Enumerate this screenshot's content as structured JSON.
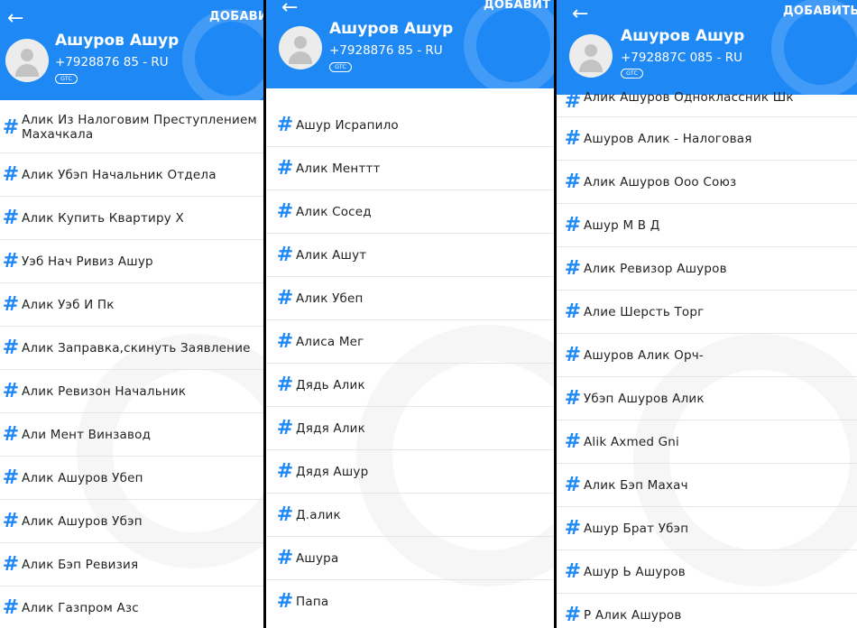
{
  "colors": {
    "accent": "#1e88f5",
    "header_text": "#ffffff",
    "item_text": "#222222"
  },
  "icons": {
    "back": "arrow-left-icon",
    "avatar": "person-icon",
    "tag": "hash-icon",
    "watermark": "phone-watermark-icon"
  },
  "panels": [
    {
      "header": {
        "back": "←",
        "add": "ДОБАВИ",
        "name": "Ашуров Ашур",
        "phone": "+7928876     85 - RU",
        "operator": "GTC"
      },
      "items": [
        "Алик Из Налоговим Преступлением Махачкала",
        "Алик Убэп Начальник Отдела",
        "Алик Купить Квартиру Х",
        "Уэб Нач Ривиз Ашур",
        "Алик Уэб И Пк",
        "Алик Заправка,скинуть Заявление",
        "Алик Ревизон Начальник",
        "Али Мент Винзавод",
        "Алик Ашуров Убеп",
        "Алик Ашуров Убэп",
        "Алик Бэп Ревизия",
        "Алик Газпром Азс"
      ]
    },
    {
      "header": {
        "back": "←",
        "add": "ДОБАВИТ",
        "name": "Ашуров Ашур",
        "phone": "+7928876     85 - RU",
        "operator": "GTC"
      },
      "items": [
        "Ашур Исрапило",
        "Алик Менттт",
        "Алик Сосед",
        "Алик Ашут",
        "Алик Убеп",
        "Алиса Мег",
        "Дядь Алик",
        "Дядя Алик",
        "Дядя Ашур",
        "Д.алик",
        "Ашура",
        "Папа"
      ]
    },
    {
      "header": {
        "back": "←",
        "add": "ДОБАВИТЬ",
        "name": "Ашуров Ашур",
        "phone": "+792887С   085 - RU",
        "operator": "GTC"
      },
      "items": [
        "Алик Ашуров Одноклассник Шк",
        "Ашуров Алик - Налоговая",
        "Алик Ашуров Ооо Союз",
        "Ашур М В Д",
        "Алик Ревизор Ашуров",
        "Алие Шерсть Торг",
        "Ашуров Алик Орч-",
        "Убэп Ашуров Алик",
        "Alik Axmed Gni",
        "Алик Бэп Махач",
        "Ашур Брат Убэп",
        "Ашур Ь Ашуров",
        "Р Алик Ашуров"
      ]
    }
  ]
}
